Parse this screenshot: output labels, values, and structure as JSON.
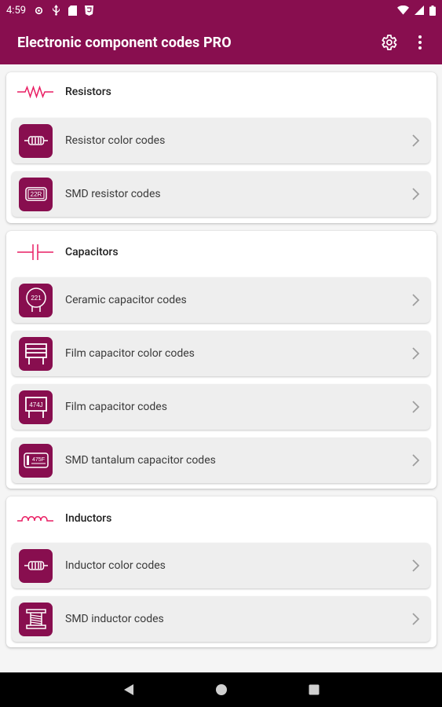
{
  "status_bar": {
    "time": "4:59"
  },
  "app_bar": {
    "title": "Electronic component codes PRO",
    "settings_icon": "gear-icon",
    "menu_icon": "more-vert-icon"
  },
  "colors": {
    "primary": "#880e4f",
    "accent": "#e91e63",
    "item_bg": "#eeeeee"
  },
  "sections": [
    {
      "title": "Resistors",
      "icon": "resistor-symbol-icon",
      "items": [
        {
          "label": "Resistor color codes",
          "icon": "resistor-color-icon"
        },
        {
          "label": "SMD resistor codes",
          "icon": "smd-resistor-icon",
          "icon_text": "22R"
        }
      ]
    },
    {
      "title": "Capacitors",
      "icon": "capacitor-symbol-icon",
      "items": [
        {
          "label": "Ceramic capacitor codes",
          "icon": "ceramic-capacitor-icon",
          "icon_text": "221"
        },
        {
          "label": "Film capacitor color codes",
          "icon": "film-capacitor-color-icon"
        },
        {
          "label": "Film capacitor codes",
          "icon": "film-capacitor-icon",
          "icon_text": "474J"
        },
        {
          "label": "SMD tantalum capacitor codes",
          "icon": "tantalum-capacitor-icon",
          "icon_text": "475F"
        }
      ]
    },
    {
      "title": "Inductors",
      "icon": "inductor-symbol-icon",
      "items": [
        {
          "label": "Inductor color codes",
          "icon": "inductor-color-icon"
        },
        {
          "label": "SMD inductor codes",
          "icon": "smd-inductor-icon"
        }
      ]
    }
  ]
}
